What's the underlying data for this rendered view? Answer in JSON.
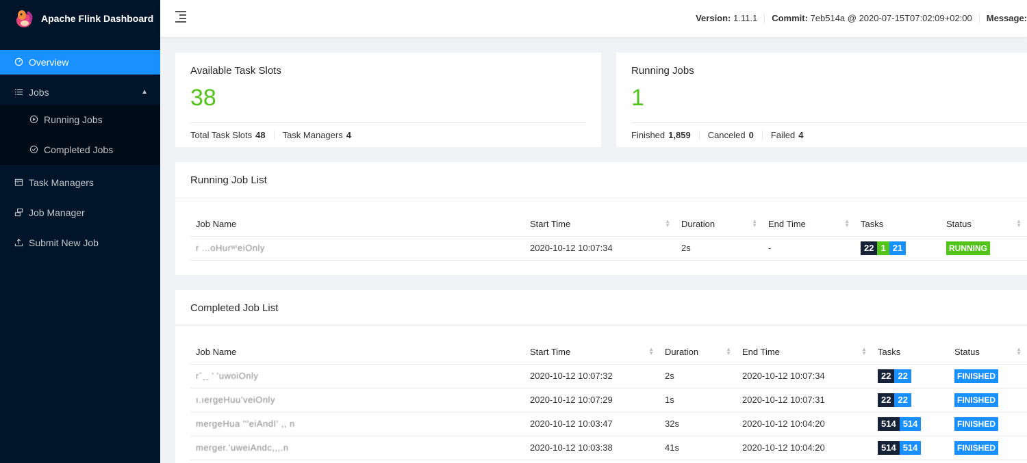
{
  "brand": {
    "title": "Apache Flink Dashboard"
  },
  "sidebar": {
    "items": [
      {
        "label": "Overview",
        "icon": "dashboard-icon"
      },
      {
        "label": "Jobs",
        "icon": "list-icon"
      },
      {
        "label": "Running Jobs",
        "icon": "play-circle-icon"
      },
      {
        "label": "Completed Jobs",
        "icon": "check-circle-icon"
      },
      {
        "label": "Task Managers",
        "icon": "schedule-icon"
      },
      {
        "label": "Job Manager",
        "icon": "cluster-icon"
      },
      {
        "label": "Submit New Job",
        "icon": "upload-icon"
      }
    ]
  },
  "header": {
    "version_label": "Version:",
    "version_value": "1.11.1",
    "commit_label": "Commit:",
    "commit_value": "7eb514a @ 2020-07-15T07:02:09+02:00",
    "message_label": "Message:"
  },
  "slots_card": {
    "title": "Available Task Slots",
    "value": "38",
    "total_label": "Total Task Slots",
    "total_value": "48",
    "tm_label": "Task Managers",
    "tm_value": "4"
  },
  "jobs_card": {
    "title": "Running Jobs",
    "value": "1",
    "finished_label": "Finished",
    "finished_value": "1,859",
    "canceled_label": "Canceled",
    "canceled_value": "0",
    "failed_label": "Failed",
    "failed_value": "4"
  },
  "running_list": {
    "title": "Running Job List",
    "columns": [
      "Job Name",
      "Start Time",
      "Duration",
      "End Time",
      "Tasks",
      "Status"
    ],
    "rows": [
      {
        "name": "r ...oHurʷⁱeiOnly",
        "start": "2020-10-12 10:07:34",
        "duration": "2s",
        "end": "-",
        "tasks_total": "22",
        "tasks_running": "1",
        "tasks_finished": "21",
        "status": "RUNNING"
      }
    ]
  },
  "completed_list": {
    "title": "Completed Job List",
    "columns": [
      "Job Name",
      "Start Time",
      "Duration",
      "End Time",
      "Tasks",
      "Status"
    ],
    "rows": [
      {
        "name": "rˉˍˍ ' ʻuwoiOnly",
        "start": "2020-10-12 10:07:32",
        "duration": "2s",
        "end": "2020-10-12 10:07:34",
        "tasks_total": "22",
        "tasks_finished": "22",
        "status": "FINISHED"
      },
      {
        "name": "ı.ıergeHuuʻveiOnly",
        "start": "2020-10-12 10:07:29",
        "duration": "1s",
        "end": "2020-10-12 10:07:31",
        "tasks_total": "22",
        "tasks_finished": "22",
        "status": "FINISHED"
      },
      {
        "name": "mergeHua '''eiAndI' ,,  n",
        "start": "2020-10-12 10:03:47",
        "duration": "32s",
        "end": "2020-10-12 10:04:20",
        "tasks_total": "514",
        "tasks_finished": "514",
        "status": "FINISHED"
      },
      {
        "name": "merger.ʻuweiAndc,,,.n",
        "start": "2020-10-12 10:03:38",
        "duration": "41s",
        "end": "2020-10-12 10:04:20",
        "tasks_total": "514",
        "tasks_finished": "514",
        "status": "FINISHED"
      }
    ]
  },
  "colors": {
    "sidebar": "#001529",
    "accent": "#1890ff",
    "success": "#52c41a",
    "dark_badge": "#162238"
  }
}
